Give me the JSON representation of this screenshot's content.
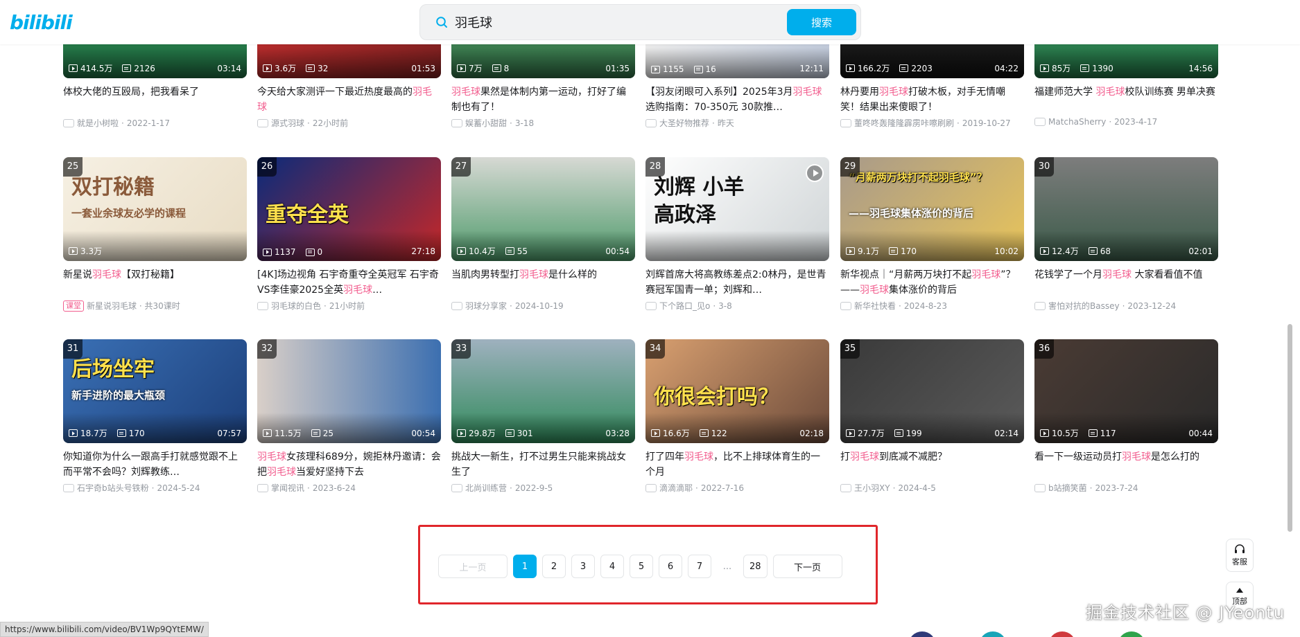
{
  "header": {
    "logo": "bilibili",
    "search_value": "羽毛球",
    "search_button": "搜索"
  },
  "cards": [
    {
      "rank": "",
      "title_parts": [
        [
          "体校大佬的互殴局，把我看呆了",
          false
        ]
      ],
      "views": "414.5万",
      "danmaku": "2126",
      "duration": "03:14",
      "up": "就是小树啦",
      "date": "2022-1-17"
    },
    {
      "rank": "",
      "title_parts": [
        [
          "今天给大家测评一下最近热度最高的",
          false
        ],
        [
          "羽毛球",
          true
        ]
      ],
      "views": "3.6万",
      "danmaku": "32",
      "duration": "01:53",
      "up": "源式羽球",
      "date": "22小时前"
    },
    {
      "rank": "",
      "title_parts": [
        [
          "羽毛球",
          true
        ],
        [
          "果然是体制内第一运动，打好了编制也有了！",
          false
        ]
      ],
      "views": "7万",
      "danmaku": "8",
      "duration": "01:35",
      "up": "娱蓄小甜甜",
      "date": "3-18"
    },
    {
      "rank": "",
      "title_parts": [
        [
          "【羽友闭眼可入系列】2025年3月",
          false
        ],
        [
          "羽毛球",
          true
        ],
        [
          "选购指南：70-350元 30款推…",
          false
        ]
      ],
      "views": "1155",
      "danmaku": "16",
      "duration": "12:11",
      "up": "大圣好物推荐",
      "date": "昨天"
    },
    {
      "rank": "",
      "title_parts": [
        [
          "林丹要用",
          false
        ],
        [
          "羽毛球",
          true
        ],
        [
          "打破木板，对手无情嘲笑！结果出来傻眼了！",
          false
        ]
      ],
      "views": "166.2万",
      "danmaku": "2203",
      "duration": "04:22",
      "up": "董咚咚轰隆隆霹雳咔嚓刷刷",
      "date": "2019-10-27"
    },
    {
      "rank": "",
      "title_parts": [
        [
          "福建师范大学 ",
          false
        ],
        [
          "羽毛球",
          true
        ],
        [
          "校队训练赛 男单决赛",
          false
        ]
      ],
      "views": "85万",
      "danmaku": "1390",
      "duration": "14:56",
      "up": "MatchaSherry",
      "date": "2023-4-17"
    },
    {
      "rank": "25",
      "title_parts": [
        [
          "新星说",
          false
        ],
        [
          "羽毛球",
          true
        ],
        [
          "【双打秘籍】",
          false
        ]
      ],
      "views": "3.3万",
      "danmaku": "",
      "duration": "",
      "up": "新星说羽毛球 · 共30课时",
      "date": "",
      "course": "课堂",
      "thumb_text": "双打秘籍",
      "thumb_sub": "一套业余球友必学的课程"
    },
    {
      "rank": "26",
      "title_parts": [
        [
          "[4K]场边视角 石宇奇重夺全英冠军 石宇奇VS李佳豪2025全英",
          false
        ],
        [
          "羽毛球",
          true
        ],
        [
          "…",
          false
        ]
      ],
      "views": "1137",
      "danmaku": "0",
      "duration": "27:18",
      "up": "羽毛球的白色",
      "date": "21小时前",
      "thumb_text": "重夺全英"
    },
    {
      "rank": "27",
      "title_parts": [
        [
          "当肌肉男转型打",
          false
        ],
        [
          "羽毛球",
          true
        ],
        [
          "是什么样的",
          false
        ]
      ],
      "views": "10.4万",
      "danmaku": "55",
      "duration": "00:54",
      "up": "羽球分享家",
      "date": "2024-10-19"
    },
    {
      "rank": "28",
      "title_parts": [
        [
          "刘辉首席大将高教练差点2:0林丹，是世青赛冠军国青一单；刘辉和…",
          false
        ]
      ],
      "views": "",
      "danmaku": "",
      "duration": "",
      "up": "下个路口_见o",
      "date": "3-8",
      "thumb_text": "刘辉 小羊",
      "thumb_sub": "高政泽"
    },
    {
      "rank": "29",
      "title_parts": [
        [
          "新华视点｜“月薪两万块打不起",
          false
        ],
        [
          "羽毛球",
          true
        ],
        [
          "”？——",
          false
        ],
        [
          "羽毛球",
          true
        ],
        [
          "集体涨价的背后",
          false
        ]
      ],
      "views": "9.1万",
      "danmaku": "170",
      "duration": "10:02",
      "up": "新华社快看",
      "date": "2024-8-23",
      "thumb_text": "“月薪两万块打不起羽毛球”？",
      "thumb_sub": "——羽毛球集体涨价的背后"
    },
    {
      "rank": "30",
      "title_parts": [
        [
          "花钱学了一个月",
          false
        ],
        [
          "羽毛球",
          true
        ],
        [
          " 大家看看值不值",
          false
        ]
      ],
      "views": "12.4万",
      "danmaku": "68",
      "duration": "02:01",
      "up": "害怕对抗的Bassey",
      "date": "2023-12-24"
    },
    {
      "rank": "31",
      "title_parts": [
        [
          "你知道你为什么一跟高手打就感觉跟不上而平常不会吗？刘辉教练…",
          false
        ]
      ],
      "views": "18.7万",
      "danmaku": "170",
      "duration": "07:57",
      "up": "石宇奇b站头号铁粉",
      "date": "2024-5-24",
      "thumb_text": "后场坐牢",
      "thumb_sub": "新手进阶的最大瓶颈"
    },
    {
      "rank": "32",
      "title_parts": [
        [
          "羽毛球",
          true
        ],
        [
          "女孩理科689分，婉拒林丹邀请：会把",
          false
        ],
        [
          "羽毛球",
          true
        ],
        [
          "当爱好坚持下去",
          false
        ]
      ],
      "views": "11.5万",
      "danmaku": "25",
      "duration": "00:54",
      "up": "掌闻视讯",
      "date": "2023-6-24"
    },
    {
      "rank": "33",
      "title_parts": [
        [
          "挑战大一新生，打不过男生只能来挑战女生了",
          false
        ]
      ],
      "views": "29.8万",
      "danmaku": "301",
      "duration": "03:28",
      "up": "北尚训练营",
      "date": "2022-9-5"
    },
    {
      "rank": "34",
      "title_parts": [
        [
          "打了四年",
          false
        ],
        [
          "羽毛球",
          true
        ],
        [
          "，比不上排球体育生的一个月",
          false
        ]
      ],
      "views": "16.6万",
      "danmaku": "122",
      "duration": "02:18",
      "up": "滴滴滴耶",
      "date": "2022-7-16",
      "thumb_text": "你很会打吗？"
    },
    {
      "rank": "35",
      "title_parts": [
        [
          "打",
          false
        ],
        [
          "羽毛球",
          true
        ],
        [
          "到底减不减肥？",
          false
        ]
      ],
      "views": "27.7万",
      "danmaku": "199",
      "duration": "02:14",
      "up": "王小羽XY",
      "date": "2024-4-5"
    },
    {
      "rank": "36",
      "title_parts": [
        [
          "看一下一级运动员打",
          false
        ],
        [
          "羽毛球",
          true
        ],
        [
          "是怎么打的",
          false
        ]
      ],
      "views": "10.5万",
      "danmaku": "117",
      "duration": "00:44",
      "up": "b站摘笑菌",
      "date": "2023-7-24"
    }
  ],
  "pagination": {
    "prev": "上一页",
    "pages": [
      "1",
      "2",
      "3",
      "4",
      "5",
      "6",
      "7"
    ],
    "ellipsis": "...",
    "last": "28",
    "next": "下一页",
    "active": "1"
  },
  "float": {
    "service": "客服",
    "top": "顶部"
  },
  "watermark": "掘金技术社区 @ JYeontu",
  "status_url": "https://www.bilibili.com/video/BV1Wp9QYtEMW/",
  "colors": {
    "accent": "#00aeec",
    "highlight": "#f25d8e",
    "annotation_box": "#e0262b"
  }
}
